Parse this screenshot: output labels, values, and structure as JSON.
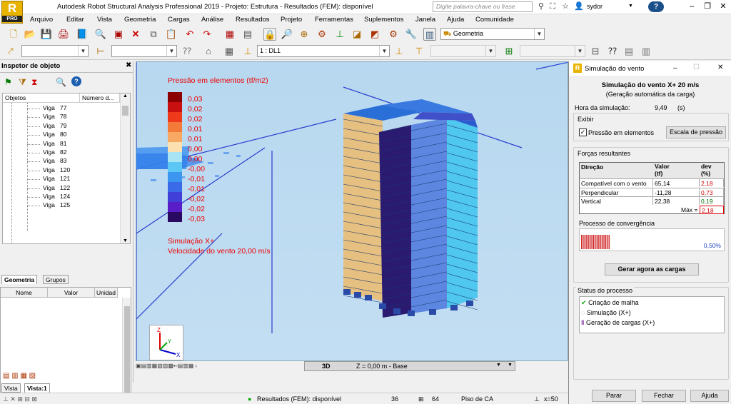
{
  "window": {
    "title": "Autodesk Robot Structural Analysis Professional 2019 - Projeto: Estrutura - Resultados (FEM): disponível",
    "logo": "PRO",
    "search_placeholder": "Digite palavra-chave ou frase",
    "user": "sydor",
    "help_label": "?"
  },
  "menu": [
    "Arquivo",
    "Editar",
    "Vista",
    "Geometria",
    "Cargas",
    "Análise",
    "Resultados",
    "Projeto",
    "Ferramentas",
    "Suplementos",
    "Janela",
    "Ajuda",
    "Comunidade"
  ],
  "toolbar": {
    "layout_combo": "Geometria",
    "load_case_combo": "1 : DL1"
  },
  "inspector": {
    "title": "Inspetor de objeto",
    "col_objetos": "Objetos",
    "col_numero": "Número d...",
    "items": [
      {
        "label": "Viga",
        "num": "77"
      },
      {
        "label": "Viga",
        "num": "78"
      },
      {
        "label": "Viga",
        "num": "79"
      },
      {
        "label": "Viga",
        "num": "80"
      },
      {
        "label": "Viga",
        "num": "81"
      },
      {
        "label": "Viga",
        "num": "82"
      },
      {
        "label": "Viga",
        "num": "83"
      },
      {
        "label": "Viga",
        "num": "120"
      },
      {
        "label": "Viga",
        "num": "121"
      },
      {
        "label": "Viga",
        "num": "122"
      },
      {
        "label": "Viga",
        "num": "124"
      },
      {
        "label": "Viga",
        "num": "125"
      }
    ],
    "tab_geometria": "Geometria",
    "tab_grupos": "Grupos",
    "prop_nome": "Nome",
    "prop_valor": "Valor",
    "prop_unidade": "Unidad",
    "vista_tab1": "Vista",
    "vista_tab2": "Vista:1"
  },
  "viewport": {
    "legend_title": "Pressão em elementos (tf/m2)",
    "legend": [
      {
        "value": "0,03",
        "color": "#8b0000"
      },
      {
        "value": "0,02",
        "color": "#c81010"
      },
      {
        "value": "0,02",
        "color": "#ee3a1a"
      },
      {
        "value": "0,01",
        "color": "#f47a3a"
      },
      {
        "value": "0,01",
        "color": "#f7a862"
      },
      {
        "value": "0,00",
        "color": "#fce0b0"
      },
      {
        "value": "0,00",
        "color": "#a8e4f4"
      },
      {
        "value": "-0,00",
        "color": "#5cc6f4"
      },
      {
        "value": "-0,01",
        "color": "#3c96f0"
      },
      {
        "value": "-0,01",
        "color": "#3a6ae8"
      },
      {
        "value": "-0,02",
        "color": "#4040d8"
      },
      {
        "value": "-0,02",
        "color": "#5a1ec8"
      },
      {
        "value": "-0,03",
        "color": "#2a0a60"
      }
    ],
    "simulation_line1": "Simulação X+",
    "simulation_line2": "Velocidade do vento 20,00 m/s",
    "view_mode": "3D",
    "z_level": "Z = 0,00 m - Base"
  },
  "status": {
    "results": "Resultados (FEM): disponível",
    "n1": "36",
    "n2": "64",
    "piso": "Piso de CA",
    "coord": "x=50"
  },
  "wind": {
    "title": "Simulação do vento",
    "heading": "Simulação do vento X+ 20 m/s",
    "subheading": "(Geração automática da carga)",
    "time_label": "Hora da simulação:",
    "time_value": "9,49",
    "time_unit": "(s)",
    "exibir": "Exibir",
    "pressao_checkbox": "Pressão em elementos",
    "pressao_checked": true,
    "escala_button": "Escala de pressão",
    "forcas_title": "Forças resultantes",
    "table_headers": [
      "Direção",
      "Valor\n(tf)",
      "dev\n(%)"
    ],
    "table_rows": [
      {
        "dir": "Compatível com o vento",
        "val": "65,14",
        "dev": "2,18",
        "dev_color": "#d00000"
      },
      {
        "dir": "Perpendicular",
        "val": "-11,28",
        "dev": "0,73",
        "dev_color": "#d00000"
      },
      {
        "dir": "Vertical",
        "val": "22,38",
        "dev": "0,19",
        "dev_color": "#007000"
      }
    ],
    "max_label": "Máx =",
    "max_value": "2,18",
    "convergence_title": "Processo de convergência",
    "convergence_value": "0,50%",
    "gerar_button": "Gerar agora as cargas",
    "status_title": "Status do processo",
    "status_items": [
      {
        "label": "Criação de malha",
        "icon": "check-icon"
      },
      {
        "label": "Simulação (X+)",
        "icon": "spinner-icon"
      },
      {
        "label": "Geração de cargas (X+)",
        "icon": "pause-icon"
      }
    ],
    "btn_parar": "Parar",
    "btn_fechar": "Fechar",
    "btn_ajuda": "Ajuda"
  }
}
